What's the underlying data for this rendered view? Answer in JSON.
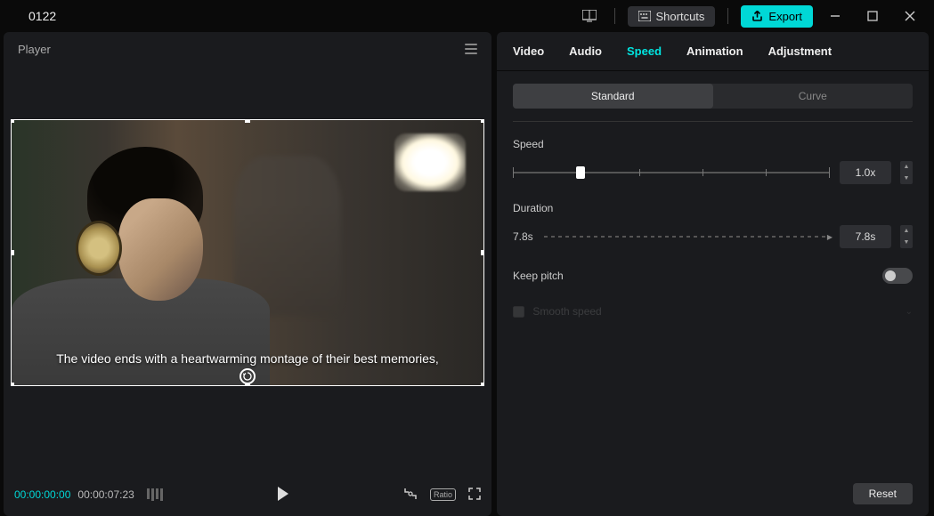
{
  "titlebar": {
    "project_name": "0122",
    "shortcuts_label": "Shortcuts",
    "export_label": "Export"
  },
  "player": {
    "header_label": "Player",
    "caption_text": "The video ends with a heartwarming montage of their best memories,",
    "time_current": "00:00:00:00",
    "time_total": "00:00:07:23",
    "ratio_label": "Ratio"
  },
  "properties": {
    "tabs": [
      "Video",
      "Audio",
      "Speed",
      "Animation",
      "Adjustment"
    ],
    "active_tab_index": 2,
    "sub_tabs": [
      "Standard",
      "Curve"
    ],
    "active_sub_tab_index": 0,
    "speed": {
      "label": "Speed",
      "value": "1.0x",
      "thumb_percent": 20
    },
    "duration": {
      "label": "Duration",
      "left_text": "7.8s",
      "value": "7.8s"
    },
    "keep_pitch": {
      "label": "Keep pitch",
      "on": false
    },
    "disabled_row": {
      "label": "Smooth speed"
    },
    "reset_label": "Reset"
  }
}
